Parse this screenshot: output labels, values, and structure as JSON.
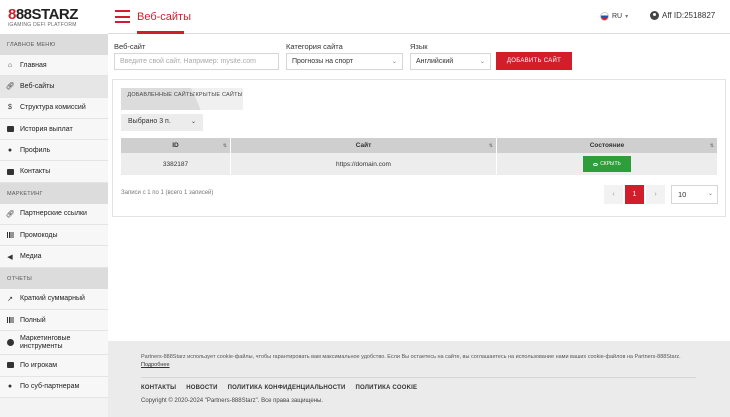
{
  "header": {
    "logo_main_prefix": "8",
    "logo_main_rest": "88STARZ",
    "logo_sub": "iGAMING DEFI PLATFORM",
    "page_title": "Веб-сайты",
    "lang": "RU",
    "aff_id": "Aff ID:2518827"
  },
  "sidebar": {
    "sections": [
      {
        "title": "ГЛАВНОЕ МЕНЮ",
        "items": [
          {
            "label": "Главная",
            "icon": "home-icon"
          },
          {
            "label": "Веб-сайты",
            "icon": "link-icon",
            "active": true
          },
          {
            "label": "Структура комиссий",
            "icon": "dollar-icon"
          },
          {
            "label": "История выплат",
            "icon": "wallet-icon"
          },
          {
            "label": "Профиль",
            "icon": "user-icon"
          },
          {
            "label": "Контакты",
            "icon": "contacts-icon"
          }
        ]
      },
      {
        "title": "МАРКЕТИНГ",
        "items": [
          {
            "label": "Партнерские ссылки",
            "icon": "link-icon"
          },
          {
            "label": "Промокоды",
            "icon": "barcode-icon"
          },
          {
            "label": "Медиа",
            "icon": "megaphone-icon"
          }
        ]
      },
      {
        "title": "ОТЧЕТЫ",
        "items": [
          {
            "label": "Краткий суммарный",
            "icon": "chart-icon"
          },
          {
            "label": "Полный",
            "icon": "chart-bars-icon"
          },
          {
            "label": "Маркетинговые инструменты",
            "icon": "palette-icon"
          },
          {
            "label": "По игрокам",
            "icon": "player-icon"
          },
          {
            "label": "По суб-партнерам",
            "icon": "users-icon"
          }
        ]
      }
    ]
  },
  "filters": {
    "website_label": "Веб-сайт",
    "website_placeholder": "Введите свой сайт. Например: mysite.com",
    "category_label": "Категория сайта",
    "category_value": "Прогнозы на спорт",
    "language_label": "Язык",
    "language_value": "Английский",
    "add_button": "ДОБАВИТЬ САЙТ"
  },
  "tabs": {
    "added": "ДОБАВЛЕННЫЕ САЙТЫ",
    "hidden": "СКРЫТЫЕ САЙТЫ"
  },
  "selected_count": "Выбрано 3 п.",
  "table": {
    "headers": [
      "ID",
      "Сайт",
      "Состояние"
    ],
    "rows": [
      {
        "id": "3382187",
        "site": "https://domain.com",
        "action": "СКРЫТЬ"
      }
    ]
  },
  "pagination": {
    "info": "Записи с 1 по 1 (всего 1 записей)",
    "prev": "‹",
    "current": "1",
    "next": "›",
    "per_page": "10"
  },
  "footer": {
    "cookie_text": "Partners-888Starz использует cookie-файлы, чтобы гарантировать вам максимальное удобство. Если Вы остаетесь на сайте, вы соглашаетесь на использование нами ваших cookie-файлов на Partners-888Starz.",
    "cookie_link": "Подробнее",
    "links": [
      "КОНТАКТЫ",
      "НОВОСТИ",
      "ПОЛИТИКА КОНФИДЕНЦИАЛЬНОСТИ",
      "ПОЛИТИКА COOKIE"
    ],
    "copyright": "Copyright © 2020-2024 \"Partners-888Starz\". Все права защищены."
  },
  "colors": {
    "accent": "#d21e2b",
    "success": "#2e9e3b"
  }
}
